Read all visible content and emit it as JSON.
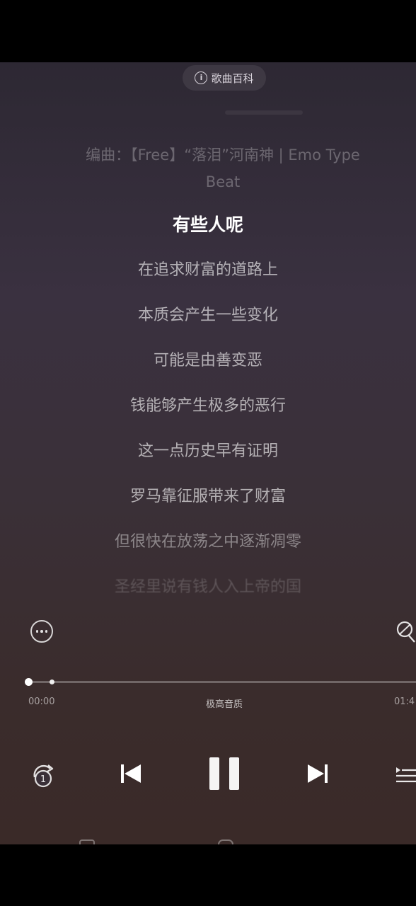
{
  "header": {
    "wiki_label": "歌曲百科",
    "info_glyph": "i"
  },
  "credit": {
    "line1": "编曲：【Free】“落泪”河南神 | Emo Type",
    "line2": "Beat"
  },
  "lyrics": [
    {
      "text": "有些人呢",
      "state": "active"
    },
    {
      "text": "在追求财富的道路上",
      "state": "normal"
    },
    {
      "text": "本质会产生一些变化",
      "state": "normal"
    },
    {
      "text": "可能是由善变恶",
      "state": "normal"
    },
    {
      "text": "钱能够产生极多的恶行",
      "state": "normal"
    },
    {
      "text": "这一点历史早有证明",
      "state": "normal"
    },
    {
      "text": "罗马靠征服带来了财富",
      "state": "normal"
    },
    {
      "text": "但很快在放荡之中逐渐凋零",
      "state": "dim"
    },
    {
      "text": "圣经里说有钱人入上帝的国",
      "state": "fade"
    }
  ],
  "player": {
    "progress_fraction": 0.0,
    "buffer_fraction": 0.06,
    "time_current": "00:00",
    "time_total": "01:4",
    "quality_label": "极高音质",
    "repeat_badge": "1"
  },
  "icons": {
    "more": "more-horizontal-icon",
    "mic": "microphone-icon",
    "repeat": "repeat-one-icon",
    "prev": "skip-previous-icon",
    "pause": "pause-icon",
    "next": "skip-next-icon",
    "playlist": "playlist-icon"
  },
  "colors": {
    "background_top": "#2d2833",
    "background_bottom": "#3a2a28",
    "active_lyric": "#ffffff"
  }
}
